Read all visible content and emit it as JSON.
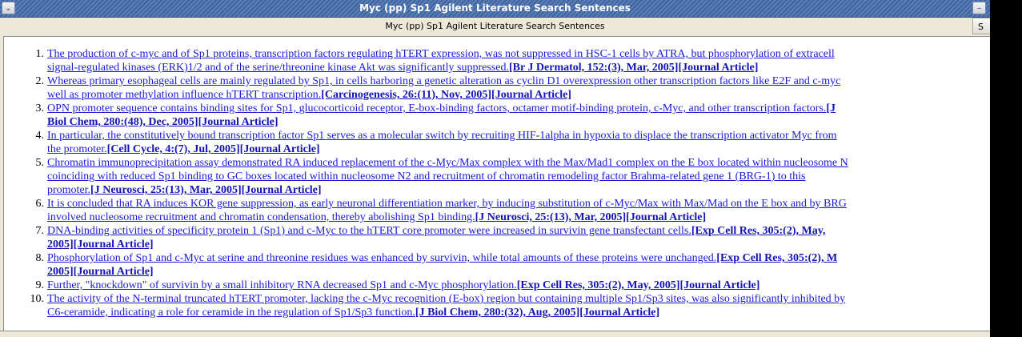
{
  "window": {
    "title": "Myc (pp) Sp1 Agilent Literature Search Sentences",
    "menu_icon": "chevron-down-icon",
    "minimize_icon": "minimize-icon"
  },
  "header": {
    "title": "Myc (pp) Sp1 Agilent Literature Search Sentences",
    "button_label": "S"
  },
  "colors": {
    "link": "#1a1ad6",
    "titlebar": "#4a6ea9"
  },
  "items": [
    {
      "num": "1.",
      "lines": [
        {
          "text": "The production of c-myc and of Sp1 proteins, transcription factors regulating hTERT expression, was not suppressed in HSC-1 cells by ATRA, but phosphorylation of extracell",
          "cite": ""
        },
        {
          "text": "signal-regulated kinases (ERK)1/2 and of the serine/threonine kinase Akt was significantly suppressed.",
          "cite": "[Br J Dermatol, 152:(3), Mar, 2005][Journal Article]"
        }
      ]
    },
    {
      "num": "2.",
      "lines": [
        {
          "text": "Whereas primary esophageal cells are mainly regulated by Sp1, in cells harboring a genetic alteration as cyclin D1 overexpression other transcription factors like E2F and c-myc",
          "cite": ""
        },
        {
          "text": "well as promoter methylation influence hTERT transcription.",
          "cite": "[Carcinogenesis, 26:(11), Nov, 2005][Journal Article]"
        }
      ]
    },
    {
      "num": "3.",
      "lines": [
        {
          "text": "OPN promoter sequence contains binding sites for Sp1, glucocorticoid receptor, E-box-binding factors, octamer motif-binding protein, c-Myc, and other transcription factors.",
          "cite": "[J"
        },
        {
          "text": "",
          "cite": "Biol Chem, 280:(48), Dec, 2005][Journal Article]"
        }
      ]
    },
    {
      "num": "4.",
      "lines": [
        {
          "text": "In particular, the constitutively bound transcription factor Sp1 serves as a molecular switch by recruiting HIF-1alpha in hypoxia to displace the transcription activator Myc from",
          "cite": ""
        },
        {
          "text": "the promoter.",
          "cite": "[Cell Cycle, 4:(7), Jul, 2005][Journal Article]"
        }
      ]
    },
    {
      "num": "5.",
      "lines": [
        {
          "text": "Chromatin immunoprecipitation assay demonstrated RA induced replacement of the c-Myc/Max complex with the Max/Mad1 complex on the E box located within nucleosome N",
          "cite": ""
        },
        {
          "text": "coinciding with reduced Sp1 binding to GC boxes located within nucleosome N2 and recruitment of chromatin remodeling factor Brahma-related gene 1 (BRG-1) to this ",
          "cite": ""
        },
        {
          "text": "promoter.",
          "cite": "[J Neurosci, 25:(13), Mar, 2005][Journal Article]"
        }
      ]
    },
    {
      "num": "6.",
      "lines": [
        {
          "text": "It is concluded that RA induces KOR gene suppression, as early neuronal differentiation marker, by inducing substitution of c-Myc/Max with Max/Mad on the E box and by BRG",
          "cite": ""
        },
        {
          "text": "involved nucleosome recruitment and chromatin condensation, thereby abolishing Sp1 binding.",
          "cite": "[J Neurosci, 25:(13), Mar, 2005][Journal Article]"
        }
      ]
    },
    {
      "num": "7.",
      "lines": [
        {
          "text": "DNA-binding activities of specificity protein 1 (Sp1) and c-Myc to the hTERT core promoter were increased in survivin gene transfectant cells.",
          "cite": "[Exp Cell Res, 305:(2), May,"
        },
        {
          "text": "",
          "cite": "2005][Journal Article]"
        }
      ]
    },
    {
      "num": "8.",
      "lines": [
        {
          "text": "Phosphorylation of Sp1 and c-Myc at serine and threonine residues was enhanced by survivin, while total amounts of these proteins were unchanged.",
          "cite": "[Exp Cell Res, 305:(2), M"
        },
        {
          "text": "",
          "cite": "2005][Journal Article]"
        }
      ]
    },
    {
      "num": "9.",
      "lines": [
        {
          "text": "Further, \"knockdown\" of survivin by a small inhibitory RNA decreased Sp1 and c-Myc phosphorylation.",
          "cite": "[Exp Cell Res, 305:(2), May, 2005][Journal Article]"
        }
      ]
    },
    {
      "num": "10.",
      "lines": [
        {
          "text": "The activity of the N-terminal truncated hTERT promoter, lacking the c-Myc recognition (E-box) region but containing multiple Sp1/Sp3 sites, was also significantly inhibited by",
          "cite": ""
        },
        {
          "text": "C6-ceramide, indicating a role for ceramide in the regulation of Sp1/Sp3 function.",
          "cite": "[J Biol Chem, 280:(32), Aug, 2005][Journal Article]"
        }
      ]
    }
  ]
}
